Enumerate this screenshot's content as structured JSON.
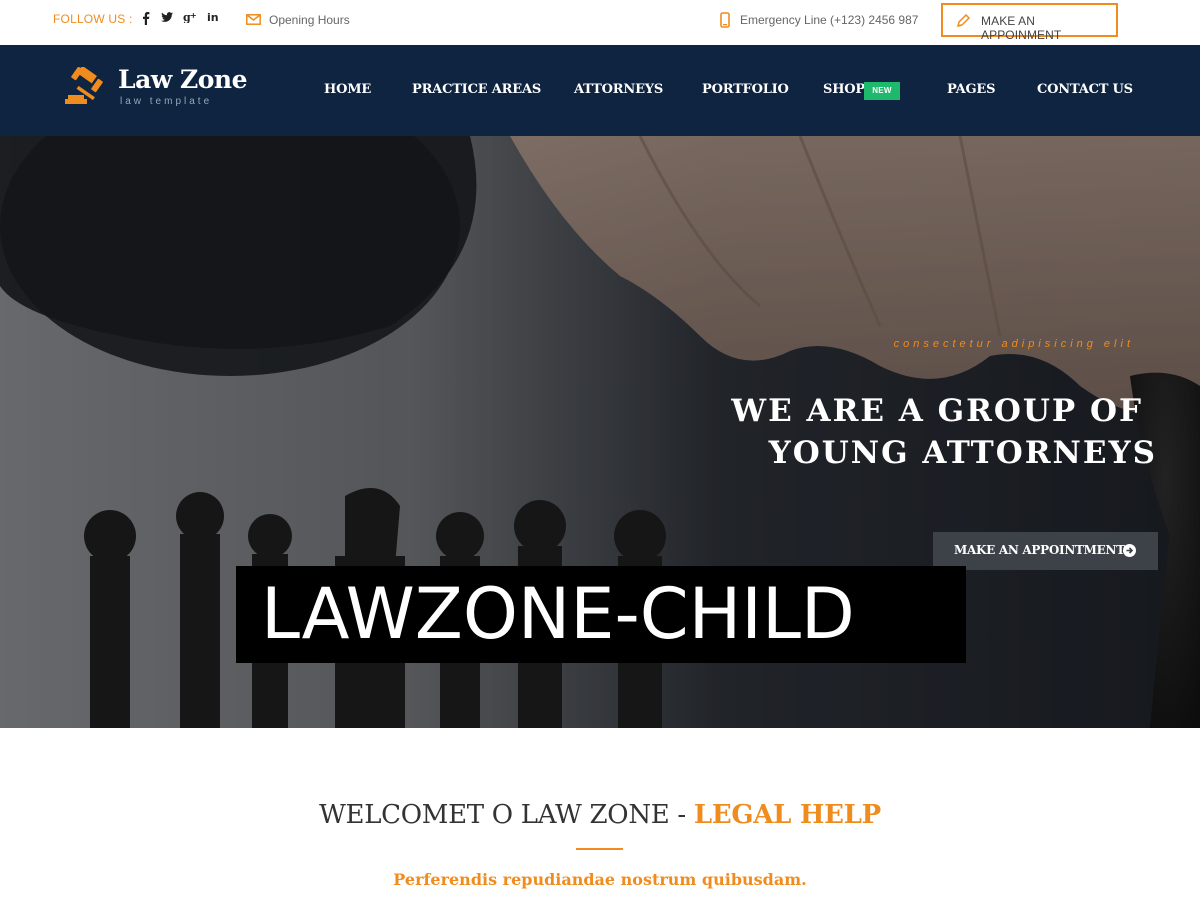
{
  "topbar": {
    "follow_label": "FOLLOW US :",
    "social_icons": [
      "facebook-icon",
      "twitter-icon",
      "google-plus-icon",
      "linkedin-icon"
    ],
    "hours_label": "Opening Hours",
    "emergency_label": "Emergency Line (+123) 2456 987",
    "appointment_label": "MAKE AN APPOINMENT"
  },
  "logo": {
    "title": "Law Zone",
    "subtitle": "law template"
  },
  "nav": {
    "items": [
      "HOME",
      "PRACTICE AREAS",
      "ATTORNEYS",
      "PORTFOLIO",
      "SHOP",
      "PAGES",
      "CONTACT US"
    ],
    "shop_badge": "NEW"
  },
  "hero": {
    "kicker": "consectetur adipisicing elit",
    "title_line1": "WE ARE A GROUP OF",
    "title_line2": "YOUNG ATTORNEYS",
    "button_label": "MAKE AN APPOINTMENT",
    "overlay_label": "LAWZONE-CHILD"
  },
  "welcome": {
    "title_dark": "WELCOMET O LAW ZONE - ",
    "title_accent": "LEGAL HELP",
    "subtitle": "Perferendis repudiandae nostrum quibusdam."
  },
  "colors": {
    "accent": "#f08c1e",
    "navbar": "#0f2440",
    "badge": "#1fb96d"
  }
}
